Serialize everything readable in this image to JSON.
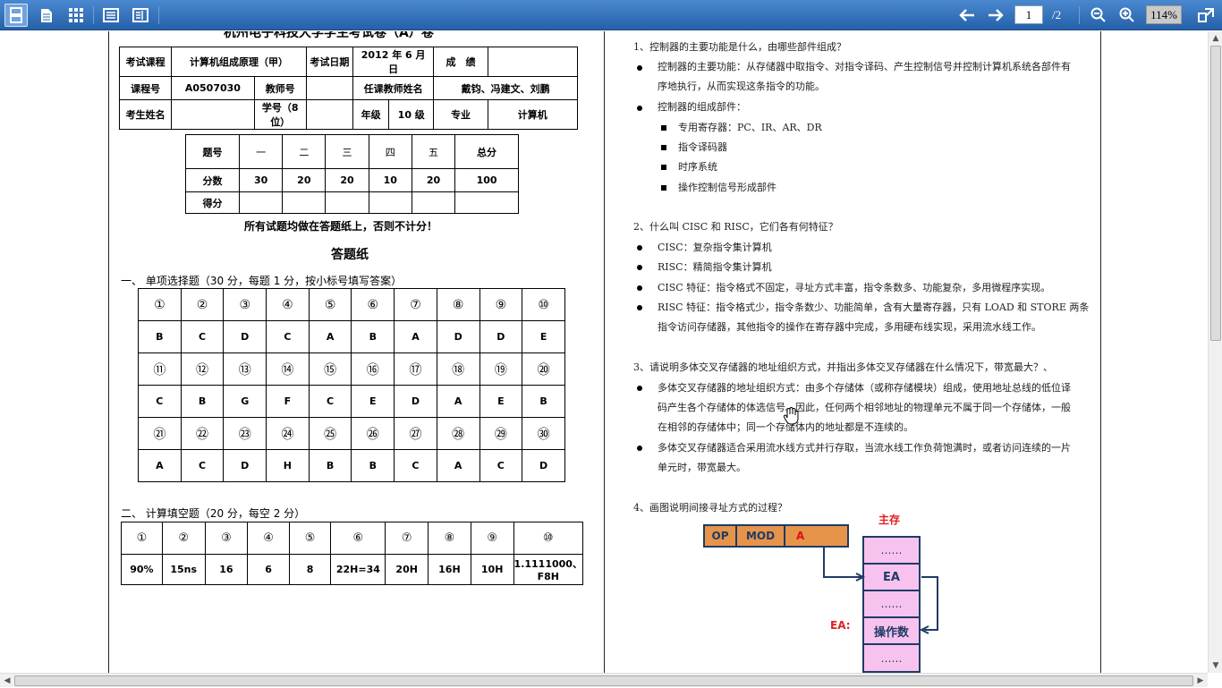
{
  "toolbar": {
    "page_current": "1",
    "page_total": "/2",
    "zoom": "114%",
    "icons": [
      "page-layout-icon",
      "document-icon",
      "thumbnails-icon",
      "bookmarks-icon",
      "outline-icon",
      "arrow-left-icon",
      "arrow-right-icon",
      "zoom-out-icon",
      "zoom-in-icon",
      "fullscreen-icon"
    ]
  },
  "left_page": {
    "title_partial": "杭州电子科技大学学生考试卷（A）卷",
    "header_table": [
      [
        "考试课程",
        "计算机组成原理（甲）",
        "考试日期",
        "2012 年 6 月　日",
        "成　绩",
        ""
      ],
      [
        "课程号",
        "A0507030",
        "教师号",
        "",
        "任课教师姓名",
        "戴钧、冯建文、刘鹏"
      ],
      [
        "考生姓名",
        "",
        "学号（8 位）",
        "",
        "年级",
        "10 级",
        "专业",
        "计算机"
      ]
    ],
    "score_table": {
      "rows": [
        [
          "题号",
          "一",
          "二",
          "三",
          "四",
          "五",
          "总分"
        ],
        [
          "分数",
          "30",
          "20",
          "20",
          "10",
          "20",
          "100"
        ],
        [
          "得分",
          "",
          "",
          "",
          "",
          "",
          ""
        ]
      ]
    },
    "notice": "所有试题均做在答题纸上，否则不计分！",
    "answer_title": "答题纸",
    "section1_title": "一、 单项选择题（30 分，每题 1 分，按小标号填写答案）",
    "mc_table": [
      [
        "①",
        "②",
        "③",
        "④",
        "⑤",
        "⑥",
        "⑦",
        "⑧",
        "⑨",
        "⑩"
      ],
      [
        "B",
        "C",
        "D",
        "C",
        "A",
        "B",
        "A",
        "D",
        "D",
        "E"
      ],
      [
        "⑪",
        "⑫",
        "⑬",
        "⑭",
        "⑮",
        "⑯",
        "⑰",
        "⑱",
        "⑲",
        "⑳"
      ],
      [
        "C",
        "B",
        "G",
        "F",
        "C",
        "E",
        "D",
        "A",
        "E",
        "B"
      ],
      [
        "㉑",
        "㉒",
        "㉓",
        "㉔",
        "㉕",
        "㉖",
        "㉗",
        "㉘",
        "㉙",
        "㉚"
      ],
      [
        "A",
        "C",
        "D",
        "H",
        "B",
        "B",
        "C",
        "A",
        "C",
        "D"
      ]
    ],
    "section2_title": "二、 计算填空题（20 分，每空 2 分）",
    "fill_table": [
      [
        "①",
        "②",
        "③",
        "④",
        "⑤",
        "⑥",
        "⑦",
        "⑧",
        "⑨",
        "⑩"
      ],
      [
        "90%",
        "15ns",
        "16",
        "6",
        "8",
        "22H=34",
        "20H",
        "16H",
        "10H",
        "1.1111000、F8H"
      ]
    ]
  },
  "right_page": {
    "q1": "1、控制器的主要功能是什么，由哪些部件组成？",
    "q1_a1_line1": "控制器的主要功能：从存储器中取指令、对指令译码、产生控制信号并控制计算机系统各部件有",
    "q1_a1_line2": "序地执行，从而实现这条指令的功能。",
    "q1_a2": "控制器的组成部件：",
    "q1_sub": [
      "专用寄存器：PC、IR、AR、DR",
      "指令译码器",
      "时序系统",
      "操作控制信号形成部件"
    ],
    "q2": "2、什么叫 CISC 和 RISC，它们各有何特征？",
    "q2_items": [
      "CISC：复杂指令集计算机",
      "RISC：精简指令集计算机",
      "CISC 特征：指令格式不固定，寻址方式丰富，指令条数多、功能复杂，多用微程序实现。"
    ],
    "q2_risc_line1": "RISC 特征：指令格式少，指令条数少、功能简单，含有大量寄存器，只有 LOAD 和 STORE 两条",
    "q2_risc_line2": "指令访问存储器，其他指令的操作在寄存器中完成，多用硬布线实现，采用流水线工作。",
    "q3": "3、请说明多体交叉存储器的地址组织方式，并指出多体交叉存储器在什么情况下，带宽最大？、",
    "q3_a1_line1": "多体交叉存储器的地址组织方式：由多个存储体（或称存储模块）组成，使用地址总线的低位译",
    "q3_a1_line2": "码产生各个存储体的体选信号。因此，任何两个相邻地址的物理单元不属于同一个存储体，一般",
    "q3_a1_line3": "在相邻的存储体中；同一个存储体内的地址都是不连续的。",
    "q3_a2_line1": "多体交叉存储器适合采用流水线方式并行存取，当流水线工作负荷饱满时，或者访问连续的一片",
    "q3_a2_line2": "单元时，带宽最大。",
    "q4": "4、画图说明间接寻址方式的过程？",
    "diagram": {
      "main_memory_label": "主存",
      "instr_fields": [
        "OP",
        "MOD",
        "A"
      ],
      "memory_cells": [
        "……",
        "EA",
        "……",
        "操作数",
        "……"
      ],
      "ea_label": "EA:"
    }
  }
}
